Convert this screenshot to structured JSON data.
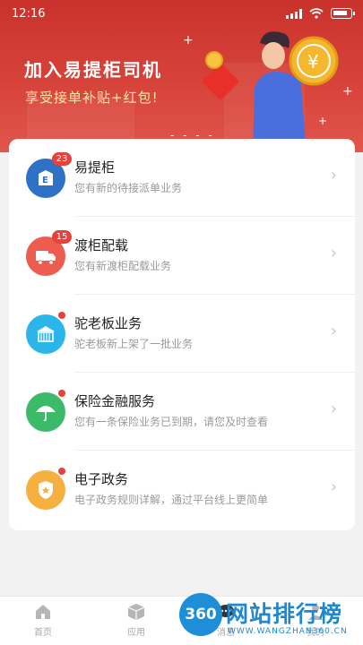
{
  "status_bar": {
    "time": "12:16"
  },
  "hero": {
    "title": "加入易提柜司机",
    "subtitle": "享受接单补贴+红包!",
    "colors": {
      "top": "#c9322b",
      "bottom": "#e0564c",
      "subtitle": "#ffe7a5"
    }
  },
  "list": {
    "items": [
      {
        "title": "易提柜",
        "desc": "您有新的待接派单业务",
        "badge": "23",
        "icon": "e-box-icon",
        "color": "#2d72c4"
      },
      {
        "title": "渡柜配载",
        "desc": "您有新渡柜配载业务",
        "badge": "15",
        "icon": "truck-icon",
        "color": "#ee5c50"
      },
      {
        "title": "驼老板业务",
        "desc": "驼老板新上架了一批业务",
        "badge": "",
        "icon": "store-icon",
        "color": "#2cb5ea"
      },
      {
        "title": "保险金融服务",
        "desc": "您有一条保险业务已到期，请您及时查看",
        "badge": "",
        "icon": "umbrella-icon",
        "color": "#3db96a"
      },
      {
        "title": "电子政务",
        "desc": "电子政务规则详解，通过平台线上更简单",
        "badge": "",
        "icon": "shield-star-icon",
        "color": "#f5b041"
      }
    ]
  },
  "tabbar": {
    "tabs": [
      {
        "label": "首页",
        "icon": "home-icon"
      },
      {
        "label": "应用",
        "icon": "cube-icon"
      },
      {
        "label": "消息",
        "icon": "chat-icon"
      },
      {
        "label": "我的",
        "icon": "person-icon"
      }
    ]
  },
  "watermark": {
    "logo": "360",
    "text": "网站排行榜",
    "url": "WWW.WANGZHAN360.CN"
  }
}
